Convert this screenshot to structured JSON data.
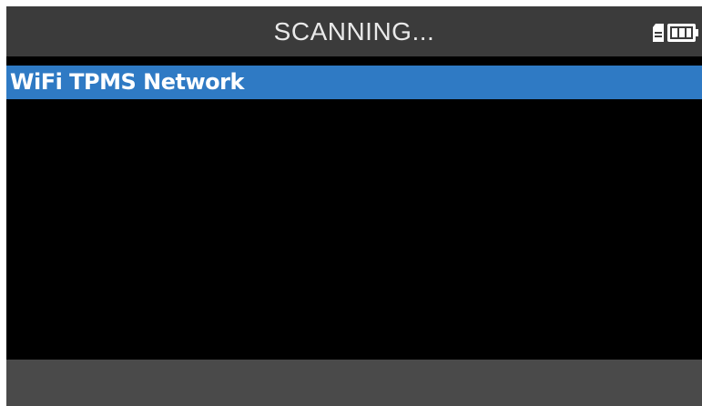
{
  "header": {
    "title": "SCANNING...",
    "status_icons": [
      "sd-card-icon",
      "battery-icon"
    ],
    "battery_level": 1.0
  },
  "list": {
    "items": [
      {
        "label": "WiFi TPMS Network",
        "selected": true
      }
    ]
  },
  "footer": {},
  "colors": {
    "header_bg": "#3b3b3b",
    "screen_bg": "#000000",
    "selection": "#2f7ac4",
    "footer_bg": "#4a4a4a",
    "text": "#ffffff"
  }
}
